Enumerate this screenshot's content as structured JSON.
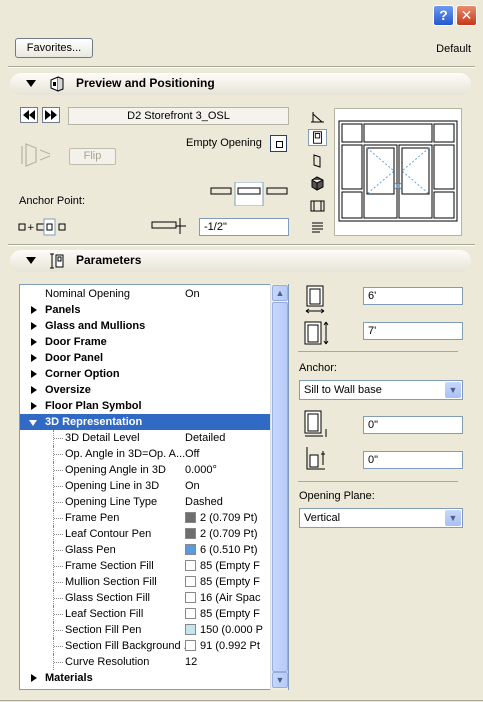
{
  "window": {
    "help_button": "?",
    "close_button": "✕"
  },
  "header": {
    "favorites_label": "Favorites...",
    "default_label": "Default"
  },
  "preview_section": {
    "title": "Preview and Positioning",
    "object_name": "D2 Storefront 3_OSL",
    "empty_opening_label": "Empty Opening",
    "flip_label": "Flip",
    "anchor_point_label": "Anchor Point:",
    "offset_value": "-1/2\""
  },
  "parameters_section": {
    "title": "Parameters",
    "tree": [
      {
        "label": "Nominal Opening",
        "value": "On",
        "type": "param",
        "indent": 0
      },
      {
        "label": "Panels",
        "type": "group"
      },
      {
        "label": "Glass and Mullions",
        "type": "group"
      },
      {
        "label": "Door Frame",
        "type": "group"
      },
      {
        "label": "Door Panel",
        "type": "group"
      },
      {
        "label": "Corner Option",
        "type": "group"
      },
      {
        "label": "Oversize",
        "type": "group"
      },
      {
        "label": "Floor Plan Symbol",
        "type": "group"
      },
      {
        "label": "3D Representation",
        "type": "group-open",
        "selected": true
      },
      {
        "label": "3D Detail Level",
        "value": "Detailed",
        "type": "child"
      },
      {
        "label": "Op. Angle in 3D=Op. A...",
        "value": "Off",
        "type": "child"
      },
      {
        "label": "Opening Angle in 3D",
        "value": "0.000°",
        "type": "child"
      },
      {
        "label": "Opening Line in 3D",
        "value": "On",
        "type": "child"
      },
      {
        "label": "Opening Line Type",
        "value": "Dashed",
        "type": "child"
      },
      {
        "label": "Frame Pen",
        "value": "2 (0.709 Pt)",
        "swatch": "#6e6e6e",
        "type": "child"
      },
      {
        "label": "Leaf Contour Pen",
        "value": "2 (0.709 Pt)",
        "swatch": "#6e6e6e",
        "type": "child"
      },
      {
        "label": "Glass Pen",
        "value": "6 (0.510 Pt)",
        "swatch": "#5a9bde",
        "type": "child"
      },
      {
        "label": "Frame Section Fill",
        "value": "85 (Empty F",
        "swatch": "#ffffff",
        "type": "child"
      },
      {
        "label": "Mullion Section Fill",
        "value": "85 (Empty F",
        "swatch": "#ffffff",
        "type": "child"
      },
      {
        "label": "Glass Section Fill",
        "value": "16 (Air Spac",
        "swatch": "#ffffff",
        "type": "child"
      },
      {
        "label": "Leaf Section Fill",
        "value": "85 (Empty F",
        "swatch": "#ffffff",
        "type": "child"
      },
      {
        "label": "Section Fill Pen",
        "value": "150 (0.000 P",
        "swatch": "#c4e6ee",
        "type": "child"
      },
      {
        "label": "Section Fill Background ...",
        "value": "91 (0.992 Pt",
        "swatch": "#ffffff",
        "type": "child"
      },
      {
        "label": "Curve Resolution",
        "value": "12",
        "type": "child"
      },
      {
        "label": "Materials",
        "type": "group"
      }
    ],
    "width_value": "6'",
    "height_value": "7'",
    "anchor_label": "Anchor:",
    "anchor_selected": "Sill to Wall base",
    "sill_value": "0\"",
    "reveal_value": "0\"",
    "opening_plane_label": "Opening Plane:",
    "opening_plane_selected": "Vertical"
  },
  "colors": {
    "selection": "#316ac5",
    "window_bg": "#ece9d8",
    "input_border": "#7f9db9"
  }
}
